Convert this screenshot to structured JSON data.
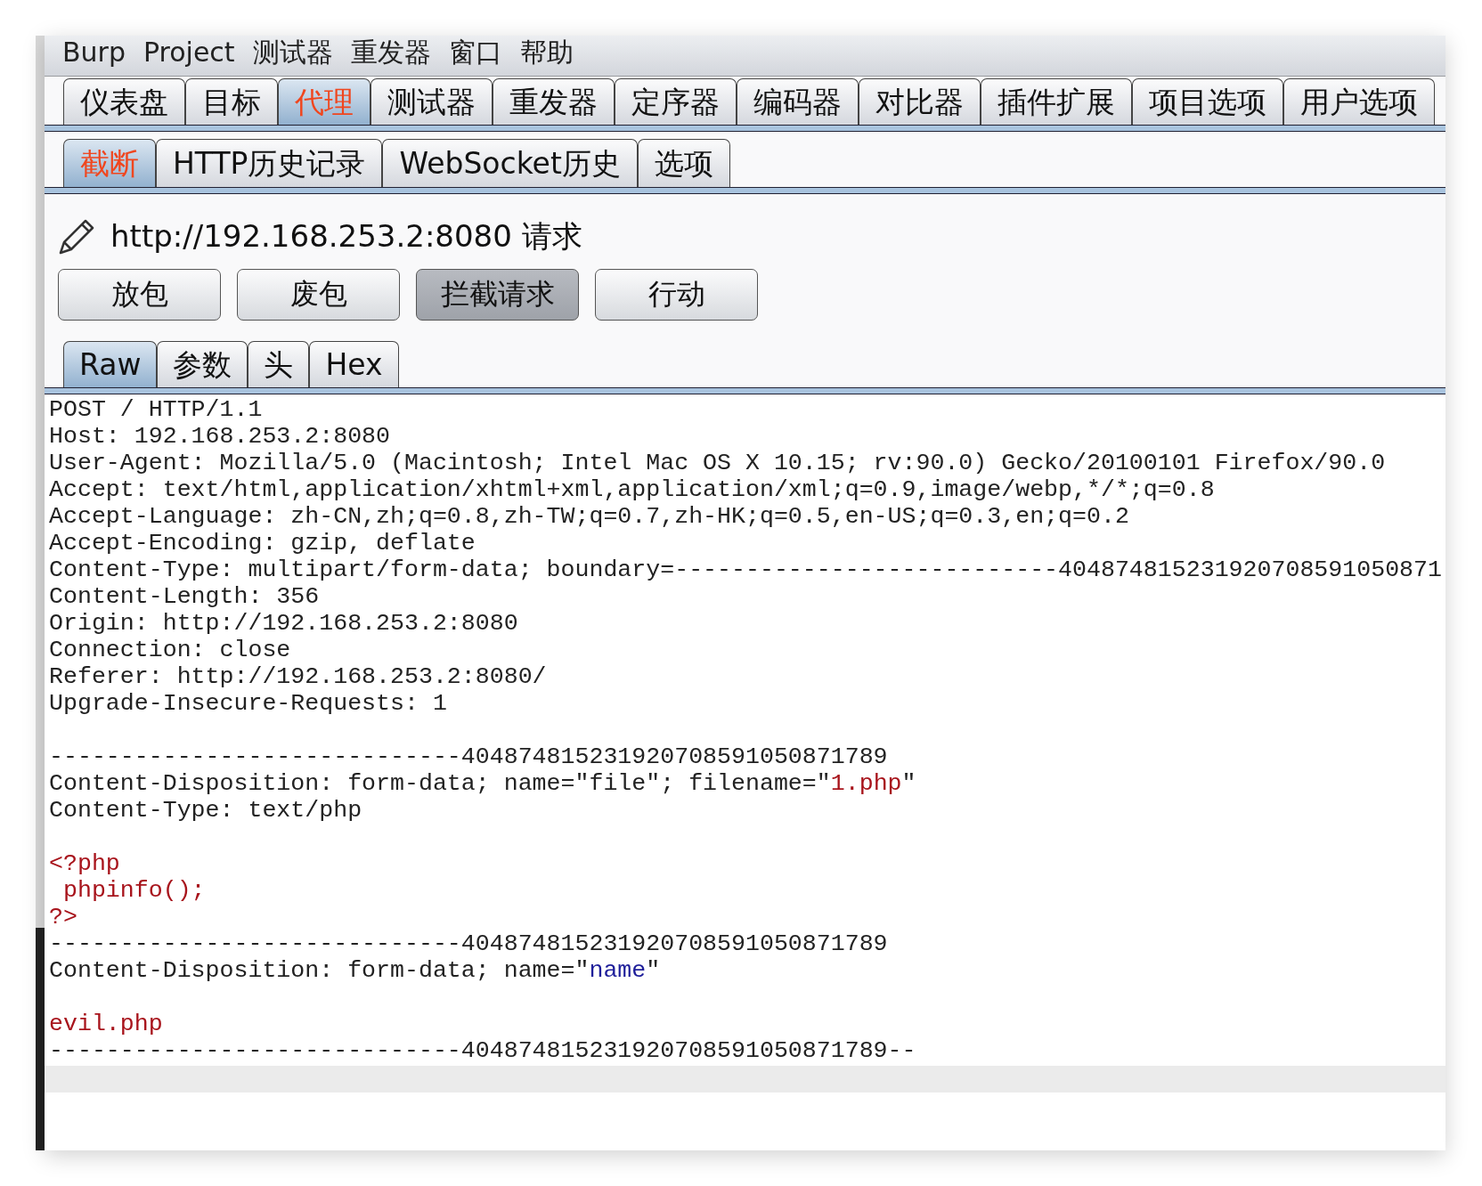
{
  "menu_bar": {
    "items": [
      "Burp",
      "Project",
      "测试器",
      "重发器",
      "窗口",
      "帮助"
    ]
  },
  "main_tabs": [
    {
      "label": "仪表盘",
      "selected": false
    },
    {
      "label": "目标",
      "selected": false
    },
    {
      "label": "代理",
      "selected": true
    },
    {
      "label": "测试器",
      "selected": false
    },
    {
      "label": "重发器",
      "selected": false
    },
    {
      "label": "定序器",
      "selected": false
    },
    {
      "label": "编码器",
      "selected": false
    },
    {
      "label": "对比器",
      "selected": false
    },
    {
      "label": "插件扩展",
      "selected": false
    },
    {
      "label": "项目选项",
      "selected": false
    },
    {
      "label": "用户选项",
      "selected": false
    }
  ],
  "sub_tabs": [
    {
      "label": "截断",
      "selected": true
    },
    {
      "label": "HTTP历史记录",
      "selected": false
    },
    {
      "label": "WebSocket历史",
      "selected": false
    },
    {
      "label": "选项",
      "selected": false
    }
  ],
  "request_title": "http://192.168.253.2:8080 请求",
  "buttons": [
    {
      "label": "放包",
      "on": false
    },
    {
      "label": "废包",
      "on": false
    },
    {
      "label": "拦截请求",
      "on": true
    },
    {
      "label": "行动",
      "on": false
    }
  ],
  "view_tabs": [
    {
      "label": "Raw",
      "selected": true
    },
    {
      "label": "参数",
      "selected": false
    },
    {
      "label": "头",
      "selected": false
    },
    {
      "label": "Hex",
      "selected": false
    }
  ],
  "editor": {
    "lines": [
      {
        "kind": "text",
        "segments": [
          {
            "text": "POST / HTTP/1.1",
            "kind": "plain"
          }
        ]
      },
      {
        "kind": "text",
        "segments": [
          {
            "text": "Host: 192.168.253.2:8080",
            "kind": "plain"
          }
        ]
      },
      {
        "kind": "text",
        "segments": [
          {
            "text": "User-Agent: Mozilla/5.0 (Macintosh; Intel Mac OS X 10.15; rv:90.0) Gecko/20100101 Firefox/90.0",
            "kind": "plain"
          }
        ]
      },
      {
        "kind": "text",
        "segments": [
          {
            "text": "Accept: text/html,application/xhtml+xml,application/xml;q=0.9,image/webp,*/*;q=0.8",
            "kind": "plain"
          }
        ]
      },
      {
        "kind": "text",
        "segments": [
          {
            "text": "Accept-Language: zh-CN,zh;q=0.8,zh-TW;q=0.7,zh-HK;q=0.5,en-US;q=0.3,en;q=0.2",
            "kind": "plain"
          }
        ]
      },
      {
        "kind": "text",
        "segments": [
          {
            "text": "Accept-Encoding: gzip, deflate",
            "kind": "plain"
          }
        ]
      },
      {
        "kind": "text",
        "segments": [
          {
            "text": "Content-Type: multipart/form-data; boundary=---------------------------404874815231920708591050871",
            "kind": "plain"
          }
        ]
      },
      {
        "kind": "text",
        "segments": [
          {
            "text": "Content-Length: 356",
            "kind": "plain"
          }
        ]
      },
      {
        "kind": "text",
        "segments": [
          {
            "text": "Origin: http://192.168.253.2:8080",
            "kind": "plain"
          }
        ]
      },
      {
        "kind": "text",
        "segments": [
          {
            "text": "Connection: close",
            "kind": "plain"
          }
        ]
      },
      {
        "kind": "text",
        "segments": [
          {
            "text": "Referer: http://192.168.253.2:8080/",
            "kind": "plain"
          }
        ]
      },
      {
        "kind": "text",
        "segments": [
          {
            "text": "Upgrade-Insecure-Requests: 1",
            "kind": "plain"
          }
        ]
      },
      {
        "kind": "blank"
      },
      {
        "kind": "text",
        "segments": [
          {
            "text": "-----------------------------404874815231920708591050871789",
            "kind": "plain"
          }
        ]
      },
      {
        "kind": "text",
        "segments": [
          {
            "text": "Content-Disposition: form-data; name=\"file\"; filename=\"",
            "kind": "plain"
          },
          {
            "text": "1.php",
            "kind": "value"
          },
          {
            "text": "\"",
            "kind": "plain"
          }
        ]
      },
      {
        "kind": "text",
        "segments": [
          {
            "text": "Content-Type: text/php",
            "kind": "plain"
          }
        ]
      },
      {
        "kind": "blank"
      },
      {
        "kind": "text",
        "segments": [
          {
            "text": "<?php",
            "kind": "value"
          }
        ]
      },
      {
        "kind": "text",
        "segments": [
          {
            "text": " phpinfo();",
            "kind": "value"
          }
        ]
      },
      {
        "kind": "text",
        "segments": [
          {
            "text": "?>",
            "kind": "value"
          }
        ]
      },
      {
        "kind": "text",
        "segments": [
          {
            "text": "-----------------------------404874815231920708591050871789",
            "kind": "plain"
          }
        ]
      },
      {
        "kind": "text",
        "segments": [
          {
            "text": "Content-Disposition: form-data; name=\"",
            "kind": "plain"
          },
          {
            "text": "name",
            "kind": "key"
          },
          {
            "text": "\"",
            "kind": "plain"
          }
        ]
      },
      {
        "kind": "blank"
      },
      {
        "kind": "text",
        "segments": [
          {
            "text": "evil.php",
            "kind": "value"
          }
        ]
      },
      {
        "kind": "text",
        "segments": [
          {
            "text": "-----------------------------404874815231920708591050871789--",
            "kind": "plain"
          }
        ]
      }
    ]
  }
}
